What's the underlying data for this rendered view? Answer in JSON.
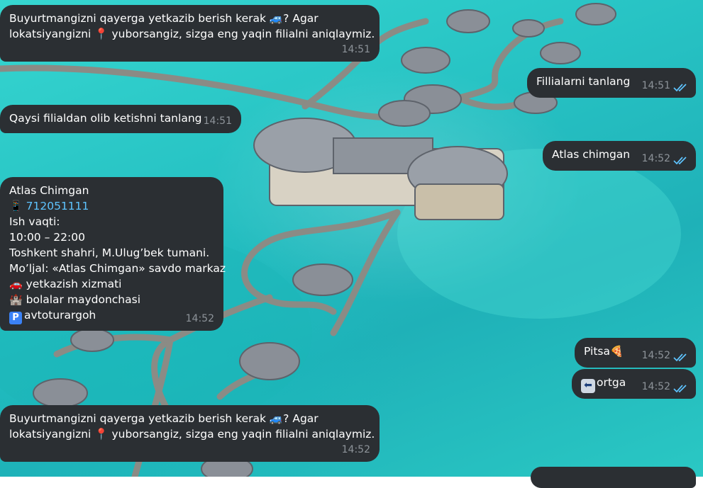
{
  "theme": {
    "bubble_bg": "#2b2f33",
    "time_color": "#8d9399",
    "link_color": "#5ec4ff",
    "tick_color": "#5ec4ff",
    "water": "#2ac8c4"
  },
  "messages": [
    {
      "dir": "in",
      "lines": [
        "Buyurtmangizni qayerga yetkazib berish kerak 🚙? Agar",
        "lokatsiyangizni 📍 yuborsangiz, sizga eng yaqin filialni aniqlaymiz."
      ],
      "time": "14:51"
    },
    {
      "dir": "out",
      "text": "Fillialarni tanlang",
      "time": "14:51"
    },
    {
      "dir": "in",
      "text": "Qaysi filialdan olib ketishni tanlang",
      "time": "14:51"
    },
    {
      "dir": "out",
      "text": "Atlas chimgan",
      "time": "14:52"
    },
    {
      "dir": "in",
      "title": "Atlas Chimgan",
      "phone_icon": "📱",
      "phone": "712051111",
      "hours_label": "Ish vaqti:",
      "hours": "10:00 – 22:00",
      "address": "Toshkent shahri, M.Ulug’bek tumani.",
      "landmark": "Mo’ljal: «Atlas Chimgan» savdo markaz",
      "features": [
        {
          "icon": "🚗",
          "text": "yetkazish xizmati"
        },
        {
          "icon": "🏰",
          "text": "bolalar maydonchasi"
        },
        {
          "icon": "P",
          "text": "avtoturargoh"
        }
      ],
      "time": "14:52"
    },
    {
      "dir": "out",
      "text": "Pitsa",
      "emoji": "🍕",
      "time": "14:52"
    },
    {
      "dir": "out",
      "icon": "⬅",
      "text": "ortga",
      "time": "14:52"
    },
    {
      "dir": "in",
      "lines": [
        "Buyurtmangizni qayerga yetkazib berish kerak 🚙? Agar",
        "lokatsiyangizni 📍 yuborsangiz, sizga eng yaqin filialni aniqlaymiz."
      ],
      "time": "14:52"
    }
  ]
}
